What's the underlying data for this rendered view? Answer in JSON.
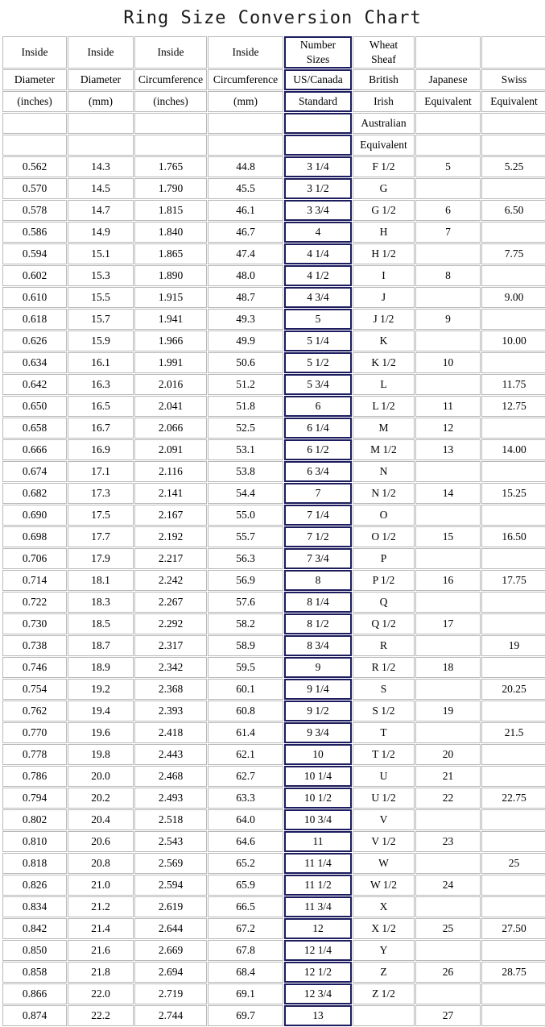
{
  "title": "Ring Size Conversion Chart",
  "accent_border_color": "#1c1c5e",
  "cell_border_color": "#b9b9b9",
  "background_color": "#ffffff",
  "highlight_column_index": 4,
  "columns": [
    {
      "key": "inside_diameter_in",
      "header_line1": "Inside",
      "header_line2": "Diameter",
      "header_line3": "(inches)",
      "header_line4": "",
      "header_line5": ""
    },
    {
      "key": "inside_diameter_mm",
      "header_line1": "Inside",
      "header_line2": "Diameter",
      "header_line3": "(mm)",
      "header_line4": "",
      "header_line5": ""
    },
    {
      "key": "inside_circumference_in",
      "header_line1": "Inside",
      "header_line2": "Circumference",
      "header_line3": "(inches)",
      "header_line4": "",
      "header_line5": ""
    },
    {
      "key": "inside_circumference_mm",
      "header_line1": "Inside",
      "header_line2": "Circumference",
      "header_line3": "(mm)",
      "header_line4": "",
      "header_line5": ""
    },
    {
      "key": "us_canada",
      "header_line1": "Number Sizes",
      "header_line1a": "Number",
      "header_line1b": "Sizes",
      "header_line2": "US/Canada",
      "header_line3": "Standard",
      "header_line4": "",
      "header_line5": ""
    },
    {
      "key": "british",
      "header_line1": "Wheat Sheaf",
      "header_line1a": "Wheat",
      "header_line1b": "Sheaf",
      "header_line2": "British",
      "header_line3": "Irish",
      "header_line4": "Australian",
      "header_line5": "Equivalent"
    },
    {
      "key": "japanese",
      "header_line1": "",
      "header_line2": "Japanese",
      "header_line3": "Equivalent",
      "header_line4": "",
      "header_line5": ""
    },
    {
      "key": "swiss",
      "header_line1": "",
      "header_line2": "Swiss",
      "header_line3": "Equivalent",
      "header_line4": "",
      "header_line5": ""
    }
  ],
  "chart_data": {
    "type": "table",
    "title": "Ring Size Conversion Chart",
    "columns": [
      "Inside Diameter (inches)",
      "Inside Diameter (mm)",
      "Inside Circumference (inches)",
      "Inside Circumference (mm)",
      "Number Sizes US/Canada Standard",
      "Wheat Sheaf British Irish Australian Equivalent",
      "Japanese Equivalent",
      "Swiss Equivalent"
    ],
    "rows": [
      [
        "0.562",
        "14.3",
        "1.765",
        "44.8",
        "3 1/4",
        "F 1/2",
        "5",
        "5.25"
      ],
      [
        "0.570",
        "14.5",
        "1.790",
        "45.5",
        "3 1/2",
        "G",
        "",
        ""
      ],
      [
        "0.578",
        "14.7",
        "1.815",
        "46.1",
        "3 3/4",
        "G 1/2",
        "6",
        "6.50"
      ],
      [
        "0.586",
        "14.9",
        "1.840",
        "46.7",
        "4",
        "H",
        "7",
        ""
      ],
      [
        "0.594",
        "15.1",
        "1.865",
        "47.4",
        "4 1/4",
        "H 1/2",
        "",
        "7.75"
      ],
      [
        "0.602",
        "15.3",
        "1.890",
        "48.0",
        "4 1/2",
        "I",
        "8",
        ""
      ],
      [
        "0.610",
        "15.5",
        "1.915",
        "48.7",
        "4 3/4",
        "J",
        "",
        "9.00"
      ],
      [
        "0.618",
        "15.7",
        "1.941",
        "49.3",
        "5",
        "J 1/2",
        "9",
        ""
      ],
      [
        "0.626",
        "15.9",
        "1.966",
        "49.9",
        "5 1/4",
        "K",
        "",
        "10.00"
      ],
      [
        "0.634",
        "16.1",
        "1.991",
        "50.6",
        "5 1/2",
        "K 1/2",
        "10",
        ""
      ],
      [
        "0.642",
        "16.3",
        "2.016",
        "51.2",
        "5 3/4",
        "L",
        "",
        "11.75"
      ],
      [
        "0.650",
        "16.5",
        "2.041",
        "51.8",
        "6",
        "L 1/2",
        "11",
        "12.75"
      ],
      [
        "0.658",
        "16.7",
        "2.066",
        "52.5",
        "6 1/4",
        "M",
        "12",
        ""
      ],
      [
        "0.666",
        "16.9",
        "2.091",
        "53.1",
        "6 1/2",
        "M 1/2",
        "13",
        "14.00"
      ],
      [
        "0.674",
        "17.1",
        "2.116",
        "53.8",
        "6 3/4",
        "N",
        "",
        ""
      ],
      [
        "0.682",
        "17.3",
        "2.141",
        "54.4",
        "7",
        "N 1/2",
        "14",
        "15.25"
      ],
      [
        "0.690",
        "17.5",
        "2.167",
        "55.0",
        "7 1/4",
        "O",
        "",
        ""
      ],
      [
        "0.698",
        "17.7",
        "2.192",
        "55.7",
        "7 1/2",
        "O 1/2",
        "15",
        "16.50"
      ],
      [
        "0.706",
        "17.9",
        "2.217",
        "56.3",
        "7 3/4",
        "P",
        "",
        ""
      ],
      [
        "0.714",
        "18.1",
        "2.242",
        "56.9",
        "8",
        "P 1/2",
        "16",
        "17.75"
      ],
      [
        "0.722",
        "18.3",
        "2.267",
        "57.6",
        "8 1/4",
        "Q",
        "",
        ""
      ],
      [
        "0.730",
        "18.5",
        "2.292",
        "58.2",
        "8 1/2",
        "Q 1/2",
        "17",
        ""
      ],
      [
        "0.738",
        "18.7",
        "2.317",
        "58.9",
        "8 3/4",
        "R",
        "",
        "19"
      ],
      [
        "0.746",
        "18.9",
        "2.342",
        "59.5",
        "9",
        "R 1/2",
        "18",
        ""
      ],
      [
        "0.754",
        "19.2",
        "2.368",
        "60.1",
        "9 1/4",
        "S",
        "",
        "20.25"
      ],
      [
        "0.762",
        "19.4",
        "2.393",
        "60.8",
        "9 1/2",
        "S 1/2",
        "19",
        ""
      ],
      [
        "0.770",
        "19.6",
        "2.418",
        "61.4",
        "9 3/4",
        "T",
        "",
        "21.5"
      ],
      [
        "0.778",
        "19.8",
        "2.443",
        "62.1",
        "10",
        "T 1/2",
        "20",
        ""
      ],
      [
        "0.786",
        "20.0",
        "2.468",
        "62.7",
        "10 1/4",
        "U",
        "21",
        ""
      ],
      [
        "0.794",
        "20.2",
        "2.493",
        "63.3",
        "10 1/2",
        "U 1/2",
        "22",
        "22.75"
      ],
      [
        "0.802",
        "20.4",
        "2.518",
        "64.0",
        "10 3/4",
        "V",
        "",
        ""
      ],
      [
        "0.810",
        "20.6",
        "2.543",
        "64.6",
        "11",
        "V 1/2",
        "23",
        ""
      ],
      [
        "0.818",
        "20.8",
        "2.569",
        "65.2",
        "11 1/4",
        "W",
        "",
        "25"
      ],
      [
        "0.826",
        "21.0",
        "2.594",
        "65.9",
        "11 1/2",
        "W 1/2",
        "24",
        ""
      ],
      [
        "0.834",
        "21.2",
        "2.619",
        "66.5",
        "11 3/4",
        "X",
        "",
        ""
      ],
      [
        "0.842",
        "21.4",
        "2.644",
        "67.2",
        "12",
        "X 1/2",
        "25",
        "27.50"
      ],
      [
        "0.850",
        "21.6",
        "2.669",
        "67.8",
        "12 1/4",
        "Y",
        "",
        ""
      ],
      [
        "0.858",
        "21.8",
        "2.694",
        "68.4",
        "12 1/2",
        "Z",
        "26",
        "28.75"
      ],
      [
        "0.866",
        "22.0",
        "2.719",
        "69.1",
        "12 3/4",
        "Z 1/2",
        "",
        ""
      ],
      [
        "0.874",
        "22.2",
        "2.744",
        "69.7",
        "13",
        "",
        "27",
        ""
      ]
    ]
  }
}
